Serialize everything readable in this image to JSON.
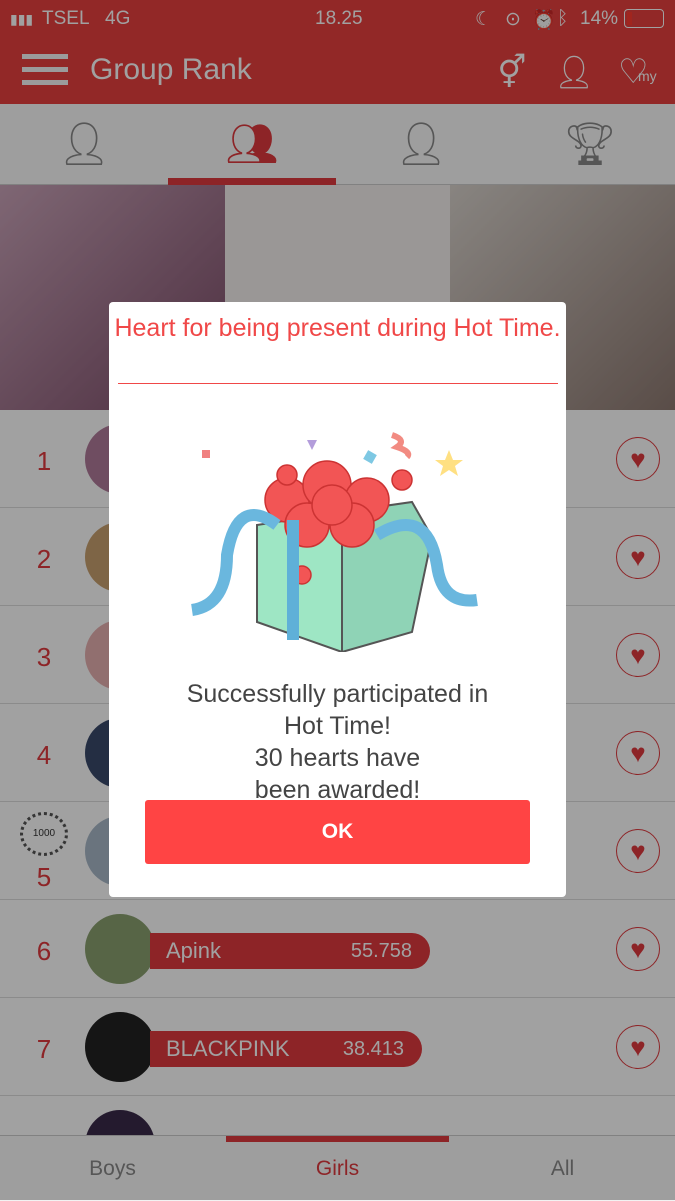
{
  "status_bar": {
    "carrier": "TSEL",
    "network": "4G",
    "time": "18.25",
    "battery": "14%"
  },
  "header": {
    "title": "Group Rank",
    "icons": [
      "gender-icon",
      "profile-icon",
      "my-heart-icon"
    ]
  },
  "tabs": [
    {
      "icon": "solo-icon"
    },
    {
      "icon": "group-icon",
      "active": true
    },
    {
      "icon": "favorite-icon"
    },
    {
      "icon": "trophy-icon"
    }
  ],
  "list": [
    {
      "rank": "1",
      "name": "",
      "score": ""
    },
    {
      "rank": "2",
      "name": "",
      "score": ""
    },
    {
      "rank": "3",
      "name": "",
      "score": ""
    },
    {
      "rank": "4",
      "name": "",
      "score": ""
    },
    {
      "rank": "5",
      "name": "",
      "score": "",
      "badge": "1000"
    },
    {
      "rank": "6",
      "name": "Apink",
      "score": "55.758"
    },
    {
      "rank": "7",
      "name": "BLACKPINK",
      "score": "38.413"
    },
    {
      "rank": "",
      "name": "",
      "score": ""
    }
  ],
  "bottom_tabs": [
    {
      "label": "Boys"
    },
    {
      "label": "Girls",
      "active": true
    },
    {
      "label": "All"
    }
  ],
  "modal": {
    "title": "Heart for being present during Hot Time.",
    "message_lines": [
      "Successfully participated in",
      "Hot Time!",
      "30 hearts have",
      "been awarded!"
    ],
    "ok_label": "OK"
  },
  "colors": {
    "accent": "#e03a3e",
    "ok_button": "#ff4444",
    "modal_title": "#f04848"
  }
}
